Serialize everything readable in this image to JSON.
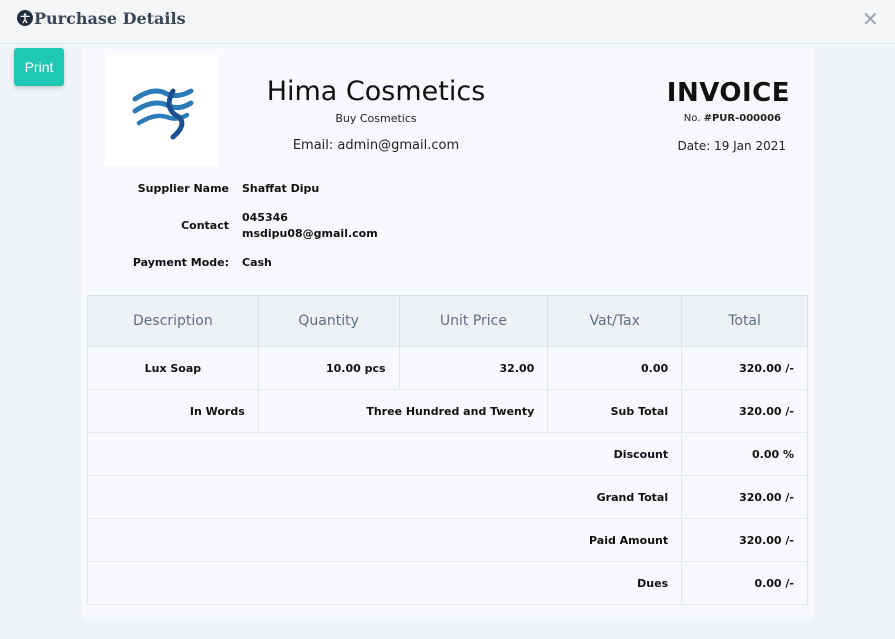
{
  "header": {
    "title": "Purchase Details",
    "title_icon": "accessibility-icon",
    "close_icon": "close-icon"
  },
  "toolbar": {
    "print_label": "Print"
  },
  "company": {
    "name": "Hima Cosmetics",
    "tagline": "Buy Cosmetics",
    "email": "Email: admin@gmail.com",
    "logo": "wave-logo",
    "logo_colors": [
      "#2b7bb9",
      "#1b4f8f"
    ]
  },
  "invoice": {
    "label": "INVOICE",
    "no_prefix": "No. ",
    "number": "#PUR-000006",
    "date": "Date: 19 Jan 2021"
  },
  "supplier": {
    "name_label": "Supplier Name",
    "name": "Shaffat Dipu",
    "contact_label": "Contact",
    "phone": "045346",
    "email": "msdipu08@gmail.com",
    "payment_label": "Payment Mode:",
    "payment_mode": "Cash"
  },
  "table": {
    "headers": [
      "Description",
      "Quantity",
      "Unit Price",
      "Vat/Tax",
      "Total"
    ],
    "items": [
      {
        "description": "Lux Soap",
        "quantity": "10.00 pcs",
        "unit_price": "32.00",
        "vat": "0.00",
        "total": "320.00 /-"
      }
    ],
    "in_words_label": "In Words",
    "in_words": "Three Hundred and Twenty",
    "summary": [
      {
        "label": "Sub Total",
        "value": "320.00 /-"
      },
      {
        "label": "Discount",
        "value": "0.00 %"
      },
      {
        "label": "Grand Total",
        "value": "320.00 /-"
      },
      {
        "label": "Paid Amount",
        "value": "320.00 /-"
      },
      {
        "label": "Dues",
        "value": "0.00 /-"
      }
    ]
  },
  "colors": {
    "accent": "#1fc8b4",
    "header_text": "#5f6f86"
  }
}
